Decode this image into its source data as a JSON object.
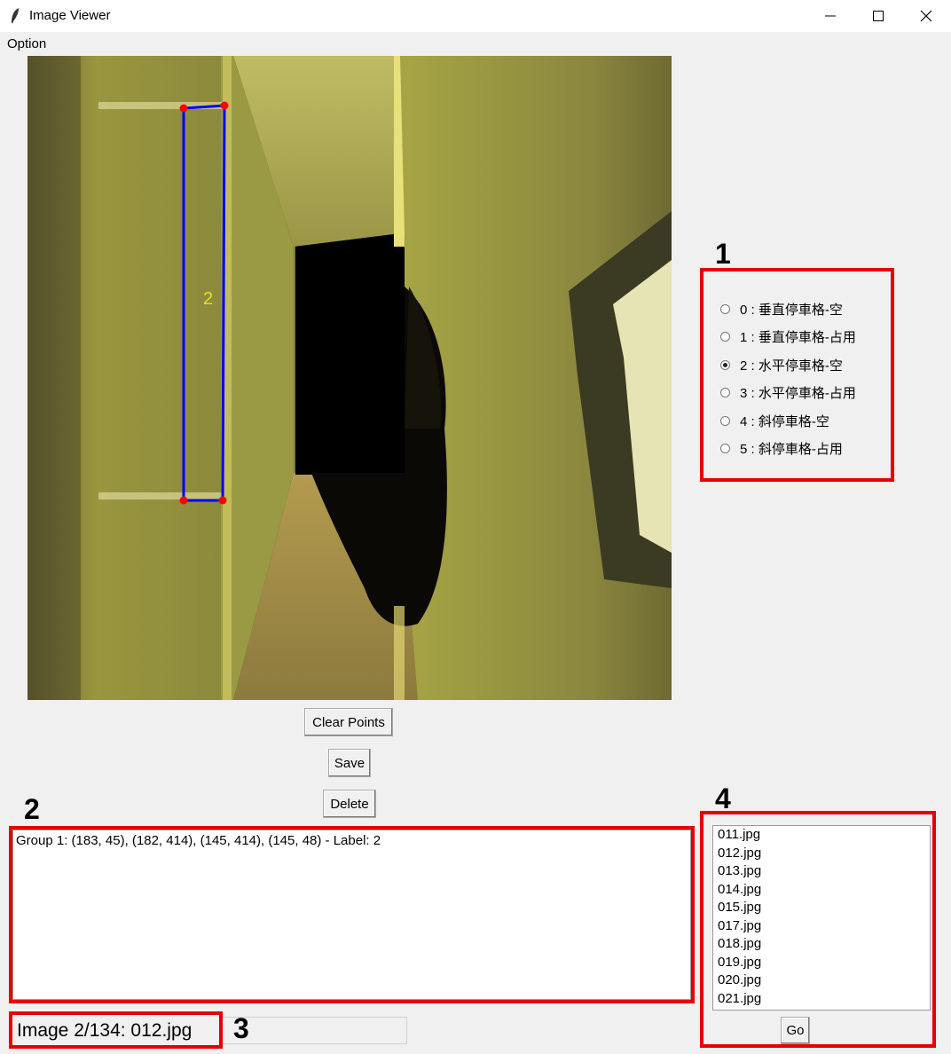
{
  "window": {
    "title": "Image Viewer"
  },
  "menu": {
    "items": [
      "Option"
    ]
  },
  "canvas": {
    "polygon_label": "2",
    "polygon_color": "#0000ff",
    "point_color": "#ff0000"
  },
  "buttons": {
    "clear_points": "Clear Points",
    "save": "Save",
    "delete": "Delete",
    "go": "Go"
  },
  "callouts": [
    "1",
    "2",
    "3",
    "4"
  ],
  "labels": {
    "selected_index": 2,
    "options": [
      "0 : 垂直停車格-空",
      "1 : 垂直停車格-占用",
      "2 : 水平停車格-空",
      "3 : 水平停車格-占用",
      "4 : 斜停車格-空",
      "5 : 斜停車格-占用"
    ]
  },
  "annotations": {
    "lines": [
      "Group 1: (183, 45), (182, 414), (145, 414), (145, 48) - Label: 2"
    ]
  },
  "status": {
    "text": "Image 2/134: 012.jpg"
  },
  "file_list": {
    "items": [
      "011.jpg",
      "012.jpg",
      "013.jpg",
      "014.jpg",
      "015.jpg",
      "017.jpg",
      "018.jpg",
      "019.jpg",
      "020.jpg",
      "021.jpg"
    ]
  },
  "colors": {
    "highlight_box": "#e60000"
  }
}
